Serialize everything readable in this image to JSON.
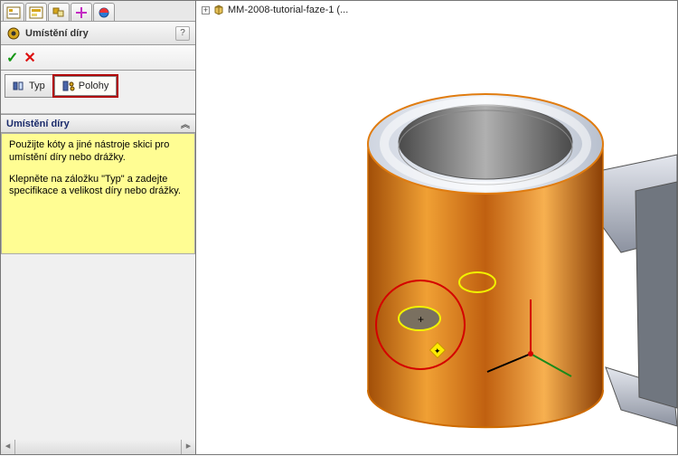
{
  "sidebar": {
    "title": "Umístění díry",
    "help": "?",
    "tabs": {
      "typ": "Typ",
      "polohy": "Polohy"
    },
    "section_head": "Umístění díry",
    "hint1": "Použijte kóty a jiné nástroje skici pro umístění díry nebo drážky.",
    "hint2": "Klepněte na záložku \"Typ\" a zadejte specifikace a velikost díry nebo drážky."
  },
  "tree": {
    "node": "MM-2008-tutorial-faze-1  (..."
  },
  "icons": {
    "ok": "✓",
    "cancel": "✕",
    "plus": "+"
  }
}
